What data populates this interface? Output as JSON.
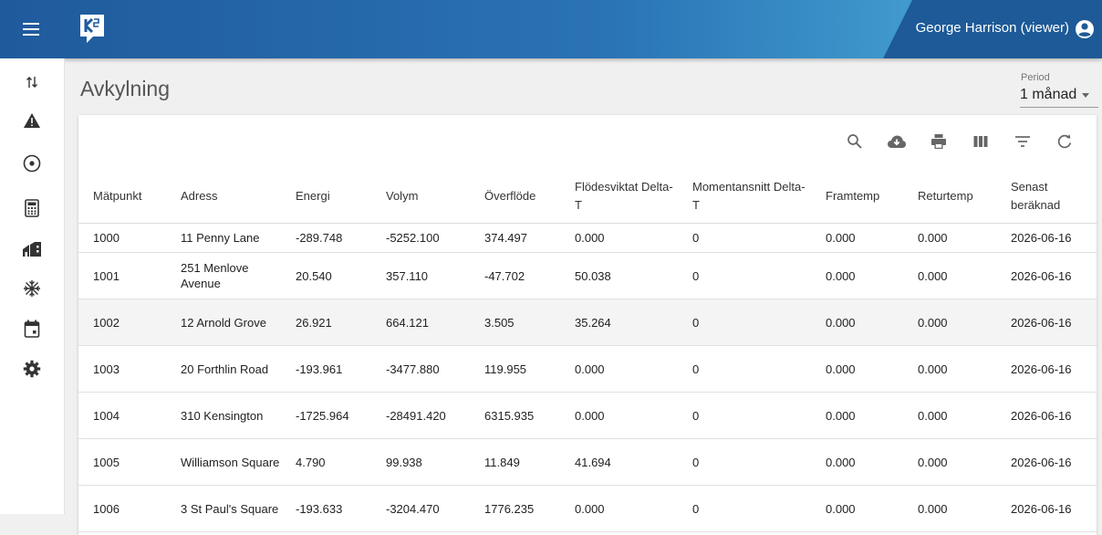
{
  "appbar": {
    "user": "George Harrison (viewer)"
  },
  "sidebar": {
    "items": [
      "transfer-icon",
      "warning-icon",
      "target-icon",
      "calculator-icon",
      "buildings-icon",
      "snowflake-icon",
      "calendar-icon",
      "settings-icon"
    ]
  },
  "page": {
    "title": "Avkylning"
  },
  "period": {
    "label": "Period",
    "value": "1 månad"
  },
  "toolbar": {
    "icons": [
      "search-icon",
      "cloud-download-icon",
      "print-icon",
      "columns-icon",
      "filter-icon",
      "refresh-icon"
    ]
  },
  "table": {
    "headers": [
      "Mätpunkt",
      "Adress",
      "Energi",
      "Volym",
      "Överflöde",
      "Flödesviktat Delta-T",
      "Momentansnitt Delta-T",
      "Framtemp",
      "Returtemp",
      "Senast beräknad"
    ],
    "rows": [
      [
        "1000",
        "11 Penny Lane",
        "-289.748",
        "-5252.100",
        "374.497",
        "0.000",
        "0",
        "0.000",
        "0.000",
        "2026-06-16"
      ],
      [
        "1001",
        "251 Menlove Avenue",
        "20.540",
        "357.110",
        "-47.702",
        "50.038",
        "0",
        "0.000",
        "0.000",
        "2026-06-16"
      ],
      [
        "1002",
        "12 Arnold Grove",
        "26.921",
        "664.121",
        "3.505",
        "35.264",
        "0",
        "0.000",
        "0.000",
        "2026-06-16"
      ],
      [
        "1003",
        "20 Forthlin Road",
        "-193.961",
        "-3477.880",
        "119.955",
        "0.000",
        "0",
        "0.000",
        "0.000",
        "2026-06-16"
      ],
      [
        "1004",
        "310 Kensington",
        "-1725.964",
        "-28491.420",
        "6315.935",
        "0.000",
        "0",
        "0.000",
        "0.000",
        "2026-06-16"
      ],
      [
        "1005",
        "Williamson Square",
        "4.790",
        "99.938",
        "11.849",
        "41.694",
        "0",
        "0.000",
        "0.000",
        "2026-06-16"
      ],
      [
        "1006",
        "3 St Paul's Square",
        "-193.633",
        "-3204.470",
        "1776.235",
        "0.000",
        "0",
        "0.000",
        "0.000",
        "2026-06-16"
      ]
    ]
  },
  "colors": {
    "appbar_start": "#1f5a9c",
    "appbar_end": "#5cb6d8",
    "highlight_row": "#f4f4f4"
  }
}
